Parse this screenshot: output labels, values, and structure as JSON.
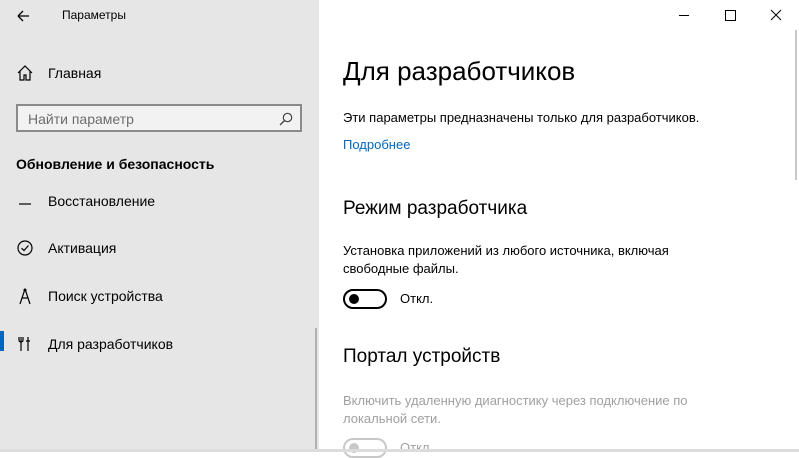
{
  "app": {
    "title": "Параметры"
  },
  "sidebar": {
    "home_label": "Главная",
    "search_placeholder": "Найти параметр",
    "section_title": "Обновление и безопасность",
    "items": [
      {
        "label": "Восстановление"
      },
      {
        "label": "Активация"
      },
      {
        "label": "Поиск устройства"
      },
      {
        "label": "Для разработчиков",
        "selected": true
      }
    ]
  },
  "main": {
    "title": "Для разработчиков",
    "description": "Эти параметры предназначены только для разработчиков.",
    "more_link": "Подробнее",
    "developer_mode": {
      "heading": "Режим разработчика",
      "description": "Установка приложений из любого источника, включая свободные файлы.",
      "toggle_state": "Откл."
    },
    "device_portal": {
      "heading": "Портал устройств",
      "description": "Включить удаленную диагностику через подключение по локальной сети.",
      "toggle_state": "Откл."
    }
  },
  "colors": {
    "accent": "#0067c0",
    "sidebar_bg": "#e6e6e6"
  },
  "icons": [
    "back-arrow-icon",
    "home-icon",
    "search-icon",
    "recovery-icon",
    "activation-icon",
    "find-device-icon",
    "developer-tools-icon",
    "minimize-icon",
    "maximize-icon",
    "close-icon"
  ]
}
